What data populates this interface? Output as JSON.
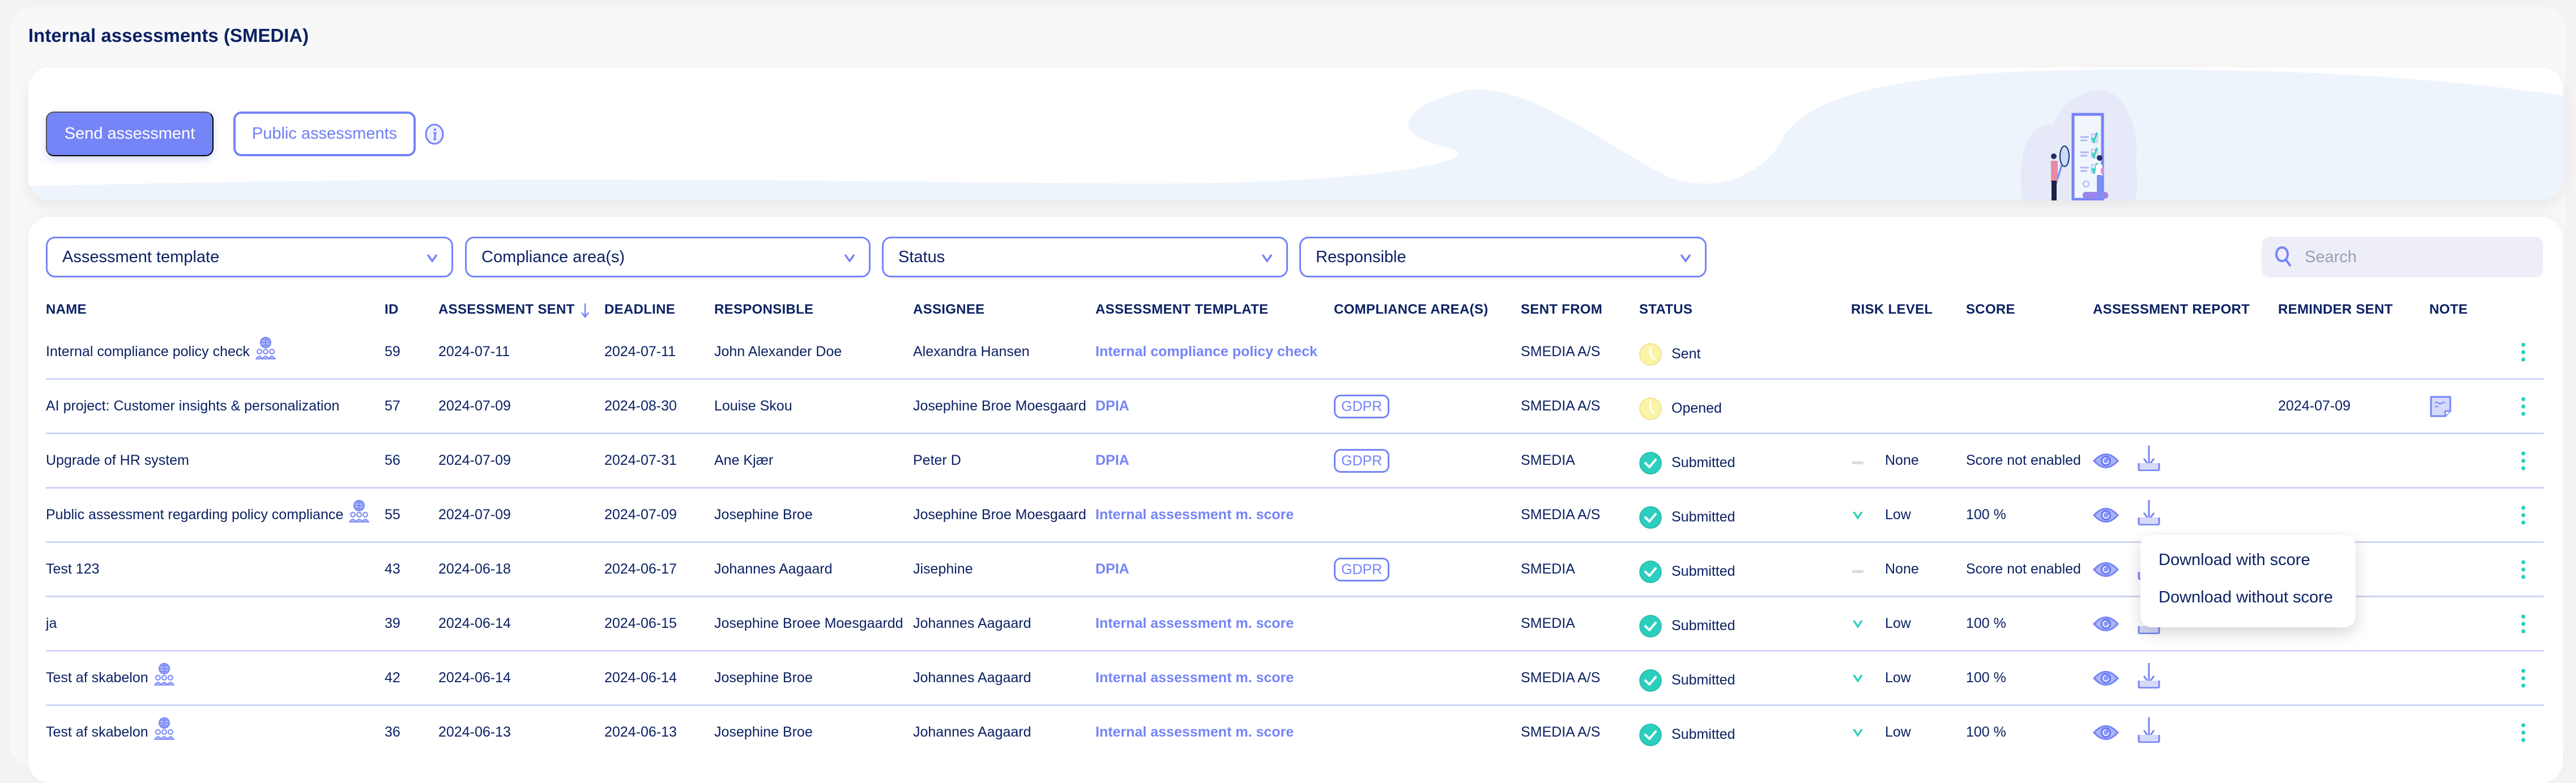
{
  "page": {
    "title": "Internal assessments (SMEDIA)"
  },
  "banner": {
    "send_button": "Send assessment",
    "public_button": "Public assessments",
    "info_icon": "info-icon",
    "illustration": "checklist-illustration"
  },
  "filters": {
    "items": [
      {
        "label": "Assessment template",
        "icon": "chevron-down-icon"
      },
      {
        "label": "Compliance area(s)",
        "icon": "chevron-down-icon"
      },
      {
        "label": "Status",
        "icon": "chevron-down-icon"
      },
      {
        "label": "Responsible",
        "icon": "chevron-down-icon"
      }
    ],
    "search_placeholder": "Search",
    "search_value": ""
  },
  "table": {
    "headers": {
      "name": "NAME",
      "id": "ID",
      "sent": "ASSESSMENT SENT",
      "deadline": "DEADLINE",
      "responsible": "RESPONSIBLE",
      "assignee": "ASSIGNEE",
      "template": "ASSESSMENT TEMPLATE",
      "compliance": "COMPLIANCE AREA(S)",
      "sent_from": "SENT FROM",
      "status": "STATUS",
      "risk": "RISK LEVEL",
      "score": "SCORE",
      "report": "ASSESSMENT REPORT",
      "reminder": "REMINDER SENT",
      "note": "NOTE"
    },
    "sort": {
      "column": "ASSESSMENT SENT",
      "direction": "descending",
      "icon": "arrow-down-icon"
    },
    "rows": [
      {
        "name": "Internal compliance policy check",
        "public": true,
        "id": "59",
        "sent": "2024-07-11",
        "deadline": "2024-07-11",
        "responsible": "John Alexander Doe",
        "assignee": "Alexandra Hansen",
        "template": "Internal compliance policy check",
        "compliance": "",
        "sent_from": "SMEDIA A/S",
        "status": "Sent",
        "status_kind": "pending",
        "risk": "",
        "risk_kind": "",
        "score": "",
        "report": false,
        "reminder": "",
        "note": false
      },
      {
        "name": "AI project: Customer insights & personalization",
        "public": false,
        "id": "57",
        "sent": "2024-07-09",
        "deadline": "2024-08-30",
        "responsible": "Louise Skou",
        "assignee": "Josephine Broe Moesgaard",
        "template": "DPIA",
        "compliance": "GDPR",
        "sent_from": "SMEDIA A/S",
        "status": "Opened",
        "status_kind": "pending",
        "risk": "",
        "risk_kind": "",
        "score": "",
        "report": false,
        "reminder": "2024-07-09",
        "note": true
      },
      {
        "name": "Upgrade of HR system",
        "public": false,
        "id": "56",
        "sent": "2024-07-09",
        "deadline": "2024-07-31",
        "responsible": "Ane Kjær",
        "assignee": "Peter D",
        "template": "DPIA",
        "compliance": "GDPR",
        "sent_from": "SMEDIA",
        "status": "Submitted",
        "status_kind": "done",
        "risk": "None",
        "risk_kind": "none",
        "score": "Score not enabled",
        "report": true,
        "reminder": "",
        "note": false
      },
      {
        "name": "Public assessment regarding policy compliance",
        "public": true,
        "id": "55",
        "sent": "2024-07-09",
        "deadline": "2024-07-09",
        "responsible": "Josephine Broe",
        "assignee": "Josephine Broe Moesgaard",
        "template": "Internal assessment m. score",
        "compliance": "",
        "sent_from": "SMEDIA A/S",
        "status": "Submitted",
        "status_kind": "done",
        "risk": "Low",
        "risk_kind": "low",
        "score": "100 %",
        "report": true,
        "reminder": "",
        "note": false
      },
      {
        "name": "Test 123",
        "public": false,
        "id": "43",
        "sent": "2024-06-18",
        "deadline": "2024-06-17",
        "responsible": "Johannes Aagaard",
        "assignee": "Jisephine",
        "template": "DPIA",
        "compliance": "GDPR",
        "sent_from": "SMEDIA",
        "status": "Submitted",
        "status_kind": "done",
        "risk": "None",
        "risk_kind": "none",
        "score": "Score not enabled",
        "report": true,
        "reminder": "",
        "note": false
      },
      {
        "name": "ja",
        "public": false,
        "id": "39",
        "sent": "2024-06-14",
        "deadline": "2024-06-15",
        "responsible": "Josephine Broee Moesgaardd",
        "assignee": "Johannes Aagaard",
        "template": "Internal assessment m. score",
        "compliance": "",
        "sent_from": "SMEDIA",
        "status": "Submitted",
        "status_kind": "done",
        "risk": "Low",
        "risk_kind": "low",
        "score": "100 %",
        "report": true,
        "reminder": "",
        "note": false
      },
      {
        "name": "Test af skabelon",
        "public": true,
        "id": "42",
        "sent": "2024-06-14",
        "deadline": "2024-06-14",
        "responsible": "Josephine Broe",
        "assignee": "Johannes Aagaard",
        "template": "Internal assessment m. score",
        "compliance": "",
        "sent_from": "SMEDIA A/S",
        "status": "Submitted",
        "status_kind": "done",
        "risk": "Low",
        "risk_kind": "low",
        "score": "100 %",
        "report": true,
        "reminder": "",
        "note": false
      },
      {
        "name": "Test af skabelon",
        "public": true,
        "id": "36",
        "sent": "2024-06-13",
        "deadline": "2024-06-13",
        "responsible": "Josephine Broe",
        "assignee": "Johannes Aagaard",
        "template": "Internal assessment m. score",
        "compliance": "",
        "sent_from": "SMEDIA A/S",
        "status": "Submitted",
        "status_kind": "done",
        "risk": "Low",
        "risk_kind": "low",
        "score": "100 %",
        "report": true,
        "reminder": "",
        "note": false
      }
    ]
  },
  "download_menu": {
    "open_for_row_id": "55",
    "items": [
      "Download with score",
      "Download without score"
    ]
  },
  "colors": {
    "primary": "#7584f7",
    "text": "#0b2163",
    "pending": "#fbf3a6",
    "success": "#2ccfbe",
    "divider": "#cfd4f6"
  }
}
